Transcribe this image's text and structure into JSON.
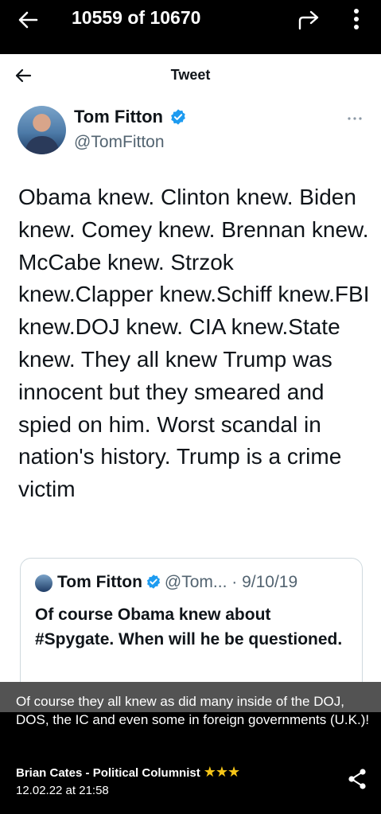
{
  "viewer": {
    "counter": "10559 of 10670"
  },
  "tweet_page": {
    "title": "Tweet",
    "author_name": "Tom Fitton",
    "author_handle": "@TomFitton",
    "text": "Obama knew. Clinton knew. Biden knew. Comey knew. Brennan knew. McCabe knew. Strzok knew.Clapper knew.Schiff knew.FBI knew.DOJ knew. CIA knew.State knew. They all knew Trump was innocent but they smeared and spied on him. Worst scandal in nation's history. Trump is a crime victim",
    "quoted": {
      "name": "Tom Fitton",
      "handle": "@Tom...",
      "date": "· 9/10/19",
      "text": "Of course Obama knew about #Spygate. When will he be questioned."
    }
  },
  "caption": {
    "text": "Of course they all knew as did many inside of the DOJ, DOS, the  IC and even some in foreign governments (U.K.)!",
    "author": "Brian Cates - Political Columnist",
    "stars": "★★★",
    "timestamp": "12.02.22 at 21:58"
  },
  "colors": {
    "verified": "#1d9bf0",
    "star": "#f5c518"
  }
}
